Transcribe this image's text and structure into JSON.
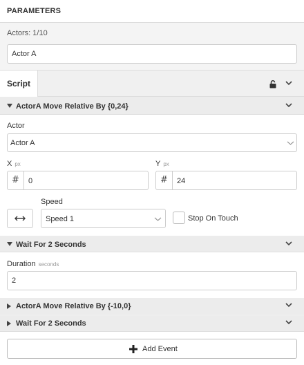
{
  "parameters_panel": {
    "title": "PARAMETERS",
    "actors_count": "Actors: 1/10",
    "actor_name_value": "Actor A"
  },
  "script_bar": {
    "tab_label": "Script",
    "lock_icon": "lock-icon",
    "menu_icon": "chevron-down-icon"
  },
  "events": [
    {
      "title": "ActorA Move Relative By {0,24}",
      "expanded": true,
      "actor_label": "Actor",
      "actor_value": "Actor A",
      "x_label": "X",
      "x_unit": "px",
      "x_value": "0",
      "y_label": "Y",
      "y_unit": "px",
      "y_value": "24",
      "speed_label": "Speed",
      "speed_value": "Speed 1",
      "stop_on_touch_label": "Stop On Touch",
      "stop_on_touch_checked": false
    },
    {
      "title": "Wait For 2 Seconds",
      "expanded": true,
      "duration_label": "Duration",
      "duration_unit": "seconds",
      "duration_value": "2"
    },
    {
      "title": "ActorA Move Relative By {-10,0}",
      "expanded": false
    },
    {
      "title": "Wait For 2 Seconds",
      "expanded": false
    }
  ],
  "add_event_label": "Add Event",
  "icons": {
    "hash": "#",
    "swap": "swap-horizontal-icon",
    "plus": "plus-icon"
  },
  "colors": {
    "panel_background": "#f4f4f4",
    "event_header_background": "#ececec",
    "border": "#cccccc",
    "text": "#333333"
  }
}
